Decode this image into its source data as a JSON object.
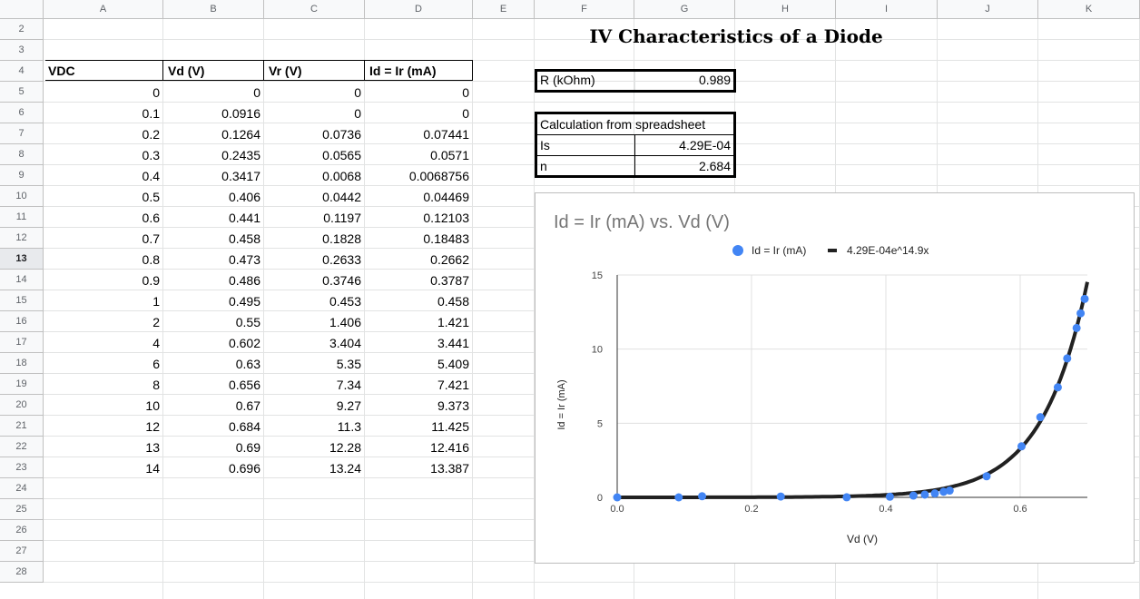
{
  "columns": [
    "A",
    "B",
    "C",
    "D",
    "E",
    "F",
    "G",
    "H",
    "I",
    "J",
    "K"
  ],
  "rows": [
    "2",
    "3",
    "4",
    "5",
    "6",
    "7",
    "8",
    "9",
    "10",
    "11",
    "12",
    "13",
    "14",
    "15",
    "16",
    "17",
    "18",
    "19",
    "20",
    "21",
    "22",
    "23",
    "24",
    "25",
    "26",
    "27",
    "28"
  ],
  "selected_row": "13",
  "title": "IV Characteristics of a Diode",
  "table": {
    "headers": [
      "VDC",
      "Vd (V)",
      "Vr (V)",
      "Id = Ir (mA)"
    ],
    "rows": [
      [
        "0",
        "0",
        "0",
        "0"
      ],
      [
        "0.1",
        "0.0916",
        "0",
        "0"
      ],
      [
        "0.2",
        "0.1264",
        "0.0736",
        "0.07441"
      ],
      [
        "0.3",
        "0.2435",
        "0.0565",
        "0.0571"
      ],
      [
        "0.4",
        "0.3417",
        "0.0068",
        "0.0068756"
      ],
      [
        "0.5",
        "0.406",
        "0.0442",
        "0.04469"
      ],
      [
        "0.6",
        "0.441",
        "0.1197",
        "0.12103"
      ],
      [
        "0.7",
        "0.458",
        "0.1828",
        "0.18483"
      ],
      [
        "0.8",
        "0.473",
        "0.2633",
        "0.2662"
      ],
      [
        "0.9",
        "0.486",
        "0.3746",
        "0.3787"
      ],
      [
        "1",
        "0.495",
        "0.453",
        "0.458"
      ],
      [
        "2",
        "0.55",
        "1.406",
        "1.421"
      ],
      [
        "4",
        "0.602",
        "3.404",
        "3.441"
      ],
      [
        "6",
        "0.63",
        "5.35",
        "5.409"
      ],
      [
        "8",
        "0.656",
        "7.34",
        "7.421"
      ],
      [
        "10",
        "0.67",
        "9.27",
        "9.373"
      ],
      [
        "12",
        "0.684",
        "11.3",
        "11.425"
      ],
      [
        "13",
        "0.69",
        "12.28",
        "12.416"
      ],
      [
        "14",
        "0.696",
        "13.24",
        "13.387"
      ]
    ]
  },
  "resistance": {
    "label": "R (kOhm)",
    "value": "0.989"
  },
  "calc": {
    "header": "Calculation from spreadsheet",
    "rows": [
      [
        "Is",
        "4.29E-04"
      ],
      [
        "n",
        "2.684"
      ]
    ]
  },
  "chart_data": {
    "type": "scatter",
    "title": "Id = Ir (mA) vs. Vd (V)",
    "xlabel": "Vd (V)",
    "ylabel": "Id = Ir (mA)",
    "xlim": [
      0,
      0.7
    ],
    "ylim": [
      0,
      15
    ],
    "xticks": [
      "0.0",
      "0.2",
      "0.4",
      "0.6"
    ],
    "yticks": [
      "0",
      "5",
      "10",
      "15"
    ],
    "grid": true,
    "legend_position": "top",
    "series": [
      {
        "name": "Id = Ir (mA)",
        "color": "#4285f4",
        "x": [
          0,
          0.0916,
          0.1264,
          0.2435,
          0.3417,
          0.406,
          0.441,
          0.458,
          0.473,
          0.486,
          0.495,
          0.55,
          0.602,
          0.63,
          0.656,
          0.67,
          0.684,
          0.69,
          0.696
        ],
        "y": [
          0,
          0,
          0.07441,
          0.0571,
          0.0068756,
          0.04469,
          0.12103,
          0.18483,
          0.2662,
          0.3787,
          0.458,
          1.421,
          3.441,
          5.409,
          7.421,
          9.373,
          11.425,
          12.416,
          13.387
        ]
      },
      {
        "name": "4.29E-04e^14.9x",
        "color": "#212121",
        "type": "trendline",
        "a": 0.000429,
        "b": 14.9
      }
    ]
  }
}
